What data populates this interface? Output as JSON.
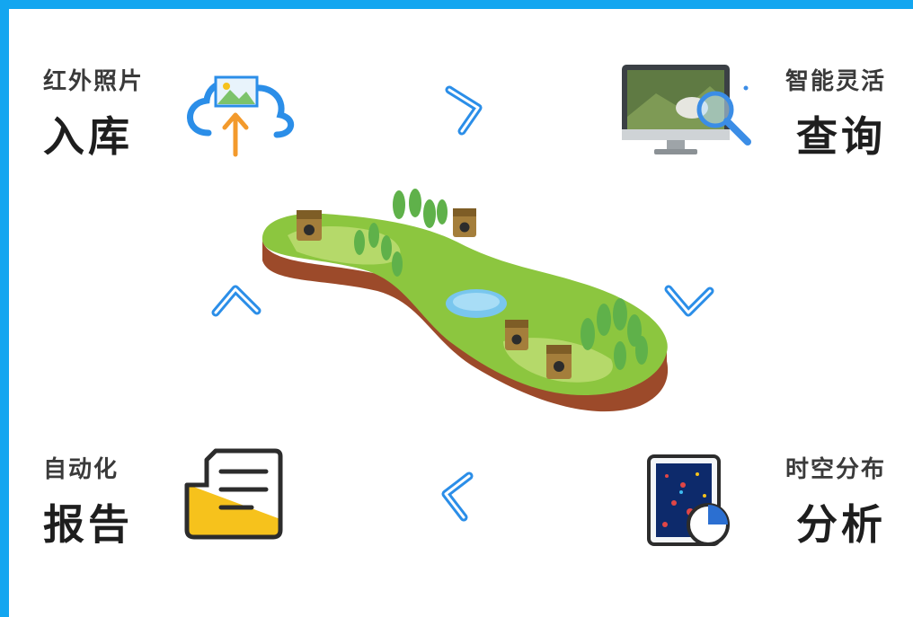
{
  "steps": {
    "top_left": {
      "small": "红外照片",
      "big": "入库",
      "icon": "cloud-upload-icon"
    },
    "top_right": {
      "small": "智能灵活",
      "big": "查询",
      "icon": "monitor-search-icon"
    },
    "bottom_left": {
      "small": "自动化",
      "big": "报告",
      "icon": "document-report-icon"
    },
    "bottom_right": {
      "small": "时空分布",
      "big": "分析",
      "icon": "map-chart-icon"
    }
  },
  "center": {
    "icon": "island-camera-trap-icon"
  },
  "arrows": [
    "arrow-right-icon",
    "arrow-down-icon",
    "arrow-left-icon",
    "arrow-up-icon"
  ],
  "colors": {
    "background": "#13a6f0",
    "accent_blue": "#2b8ee8",
    "accent_orange": "#f39a2c",
    "accent_yellow": "#f6c21c",
    "text": "#2a2a2a"
  }
}
